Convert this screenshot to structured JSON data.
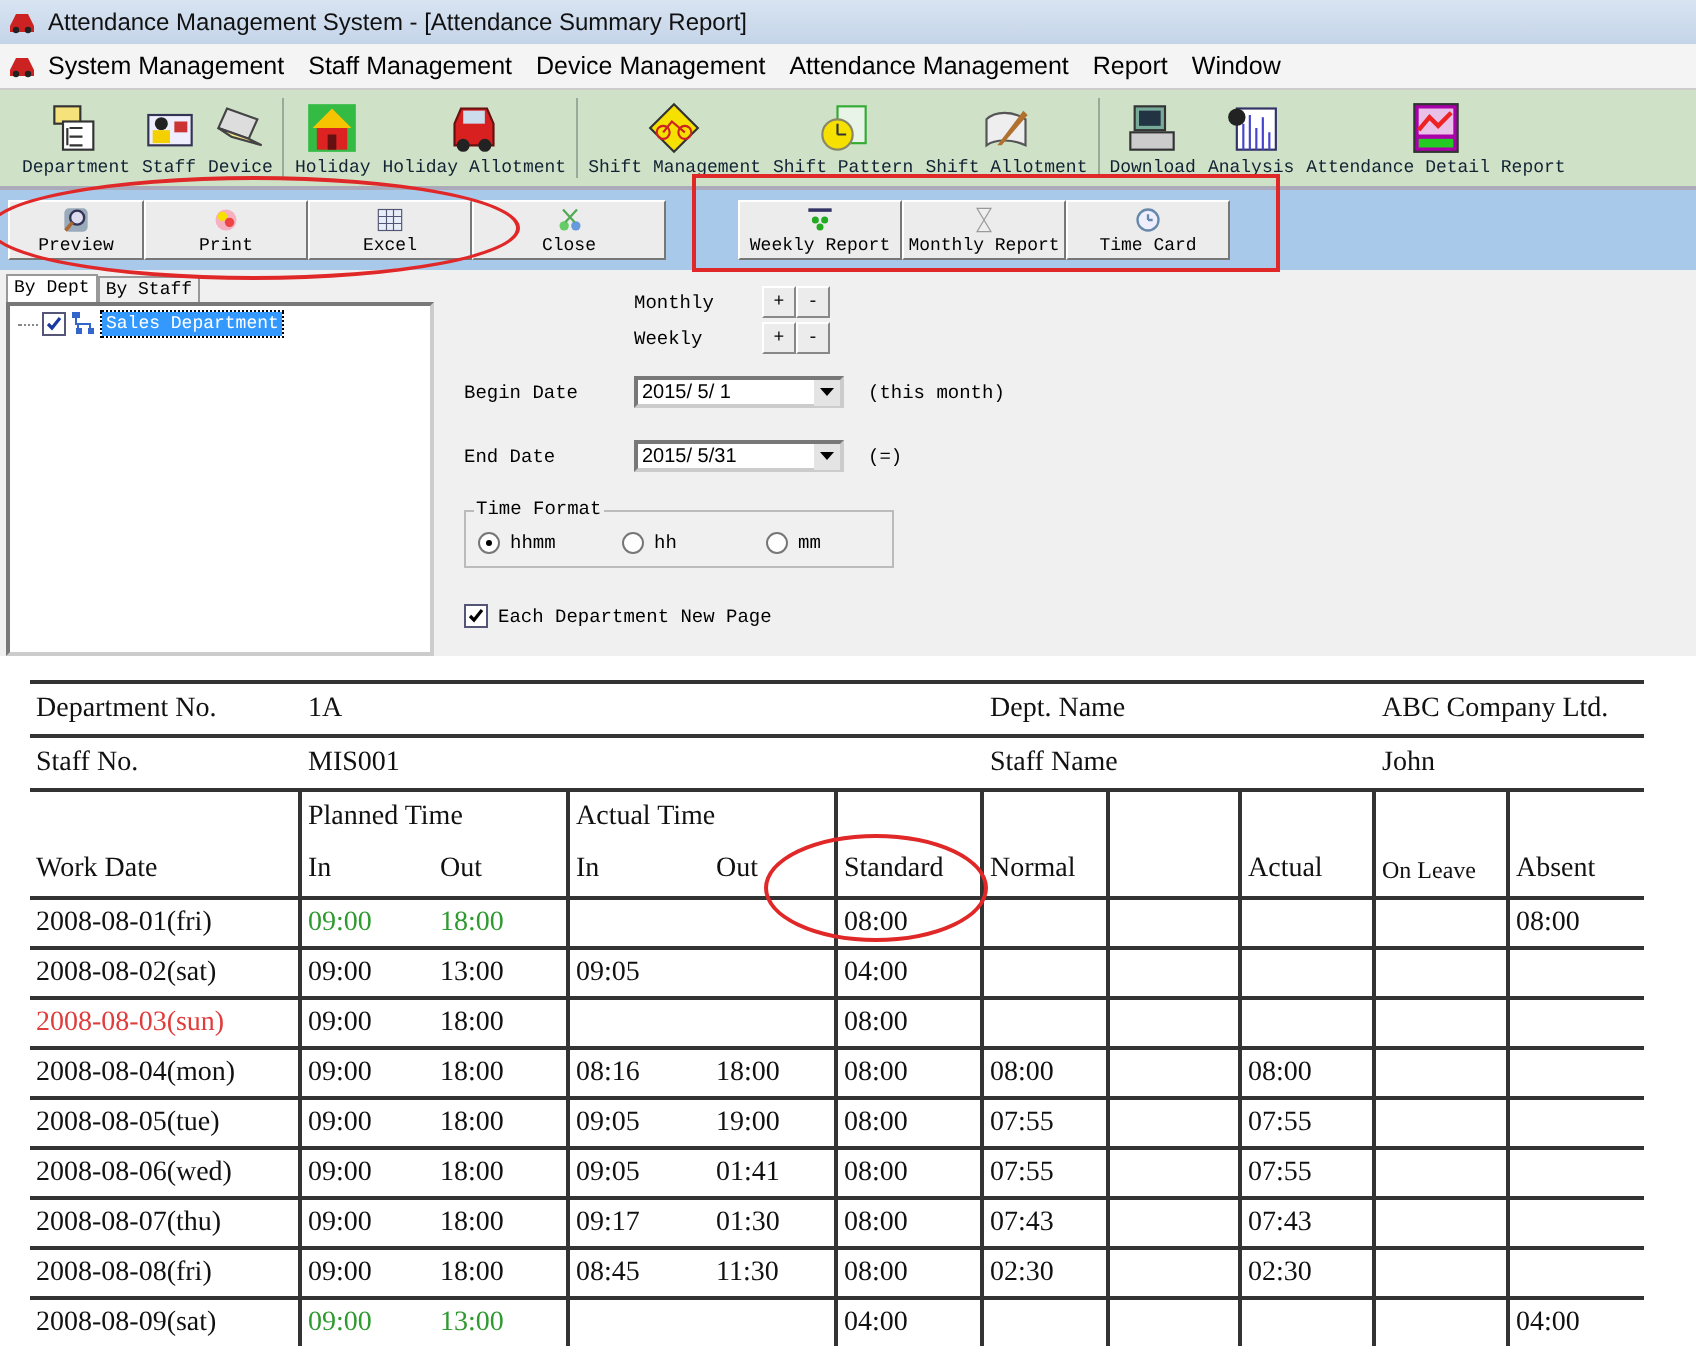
{
  "window": {
    "title": "Attendance Management System - [Attendance Summary Report]"
  },
  "menu": [
    "System Management",
    "Staff Management",
    "Device Management",
    "Attendance Management",
    "Report",
    "Window"
  ],
  "toolbar_groups": [
    [
      {
        "label": "Department",
        "kind": "department"
      },
      {
        "label": "Staff",
        "kind": "staff"
      },
      {
        "label": "Device",
        "kind": "device"
      }
    ],
    [
      {
        "label": "Holiday",
        "kind": "holiday"
      },
      {
        "label": "Holiday Allotment",
        "kind": "car"
      }
    ],
    [
      {
        "label": "Shift Management",
        "kind": "bicycle"
      },
      {
        "label": "Shift Pattern",
        "kind": "pattern"
      },
      {
        "label": "Shift Allotment",
        "kind": "quill"
      }
    ],
    [
      {
        "label": "Download",
        "kind": "computer"
      },
      {
        "label": "Analysis",
        "kind": "analysis"
      },
      {
        "label": "Attendance Detail Report",
        "kind": "linechart"
      }
    ]
  ],
  "actions": [
    {
      "label": "Preview",
      "kind": "preview"
    },
    {
      "label": "Print",
      "kind": "print"
    },
    {
      "label": "Excel",
      "kind": "excel"
    },
    {
      "label": "Close",
      "kind": "close"
    }
  ],
  "reports": [
    {
      "label": "Weekly Report",
      "kind": "weekly"
    },
    {
      "label": "Monthly Report",
      "kind": "monthly"
    },
    {
      "label": "Time Card",
      "kind": "clock"
    }
  ],
  "tabs": [
    {
      "label": "By Dept",
      "selected": true
    },
    {
      "label": "By Staff",
      "selected": false
    }
  ],
  "tree": [
    {
      "label": "Sales Department",
      "checked": true,
      "selected": true
    }
  ],
  "form": {
    "periods": [
      {
        "label": "Monthly",
        "buttons": [
          "+",
          "-"
        ]
      },
      {
        "label": "Weekly",
        "buttons": [
          "+",
          "-"
        ]
      }
    ],
    "dates": [
      {
        "label": "Begin Date",
        "value": "2015/ 5/ 1",
        "note": "(this month)"
      },
      {
        "label": "End Date",
        "value": "2015/ 5/31",
        "note": "(=)"
      }
    ],
    "time_format": {
      "title": "Time Format",
      "options": [
        {
          "label": "hhmm",
          "selected": true
        },
        {
          "label": "hh",
          "selected": false
        },
        {
          "label": "mm",
          "selected": false
        }
      ]
    },
    "new_page": {
      "label": "Each Department New Page",
      "checked": true
    }
  },
  "report": {
    "info": [
      {
        "label": "Department No.",
        "value": "1A",
        "label_2": "Dept. Name",
        "value_2": "ABC Company Ltd."
      },
      {
        "label": "Staff No.",
        "value": "MIS001",
        "label_2": "Staff Name",
        "value_2": "John"
      }
    ],
    "columns": [
      {
        "label": "Work Date"
      },
      {
        "group": "Planned Time",
        "label": "In"
      },
      {
        "label": "Out"
      },
      {
        "group": "Actual Time",
        "label": "In"
      },
      {
        "label": "Out"
      },
      {
        "label": "Standard"
      },
      {
        "label": "Normal"
      },
      {},
      {
        "label": "Actual"
      },
      {
        "label": "On Leave"
      },
      {
        "label": "Absent"
      }
    ],
    "rows": [
      [
        {
          "text": "2008-08-01(fri)"
        },
        {
          "text": "09:00",
          "color": "#2f9a2f"
        },
        {
          "text": "18:00",
          "color": "#2f9a2f"
        },
        null,
        null,
        {
          "text": "08:00"
        },
        null,
        null,
        null,
        null,
        {
          "text": "08:00"
        }
      ],
      [
        {
          "text": "2008-08-02(sat)"
        },
        {
          "text": "09:00"
        },
        {
          "text": "13:00"
        },
        {
          "text": "09:05"
        },
        null,
        {
          "text": "04:00"
        },
        null,
        null,
        null,
        null,
        null
      ],
      [
        {
          "text": "2008-08-03(sun)",
          "color": "#e03c3c"
        },
        {
          "text": "09:00"
        },
        {
          "text": "18:00"
        },
        null,
        null,
        {
          "text": "08:00"
        },
        null,
        null,
        null,
        null,
        null
      ],
      [
        {
          "text": "2008-08-04(mon)"
        },
        {
          "text": "09:00"
        },
        {
          "text": "18:00"
        },
        {
          "text": "08:16"
        },
        {
          "text": "18:00"
        },
        {
          "text": "08:00"
        },
        {
          "text": "08:00"
        },
        null,
        {
          "text": "08:00"
        },
        null,
        null
      ],
      [
        {
          "text": "2008-08-05(tue)"
        },
        {
          "text": "09:00"
        },
        {
          "text": "18:00"
        },
        {
          "text": "09:05"
        },
        {
          "text": "19:00"
        },
        {
          "text": "08:00"
        },
        {
          "text": "07:55"
        },
        null,
        {
          "text": "07:55"
        },
        null,
        null
      ],
      [
        {
          "text": "2008-08-06(wed)"
        },
        {
          "text": "09:00"
        },
        {
          "text": "18:00"
        },
        {
          "text": "09:05"
        },
        {
          "text": "01:41"
        },
        {
          "text": "08:00"
        },
        {
          "text": "07:55"
        },
        null,
        {
          "text": "07:55"
        },
        null,
        null
      ],
      [
        {
          "text": "2008-08-07(thu)"
        },
        {
          "text": "09:00"
        },
        {
          "text": "18:00"
        },
        {
          "text": "09:17"
        },
        {
          "text": "01:30"
        },
        {
          "text": "08:00"
        },
        {
          "text": "07:43"
        },
        null,
        {
          "text": "07:43"
        },
        null,
        null
      ],
      [
        {
          "text": "2008-08-08(fri)"
        },
        {
          "text": "09:00"
        },
        {
          "text": "18:00"
        },
        {
          "text": "08:45"
        },
        {
          "text": "11:30"
        },
        {
          "text": "08:00"
        },
        {
          "text": "02:30"
        },
        null,
        {
          "text": "02:30"
        },
        null,
        null
      ],
      [
        {
          "text": "2008-08-09(sat)"
        },
        {
          "text": "09:00",
          "color": "#2f9a2f"
        },
        {
          "text": "13:00",
          "color": "#2f9a2f"
        },
        null,
        null,
        {
          "text": "04:00"
        },
        null,
        null,
        null,
        null,
        {
          "text": "04:00"
        }
      ]
    ]
  }
}
